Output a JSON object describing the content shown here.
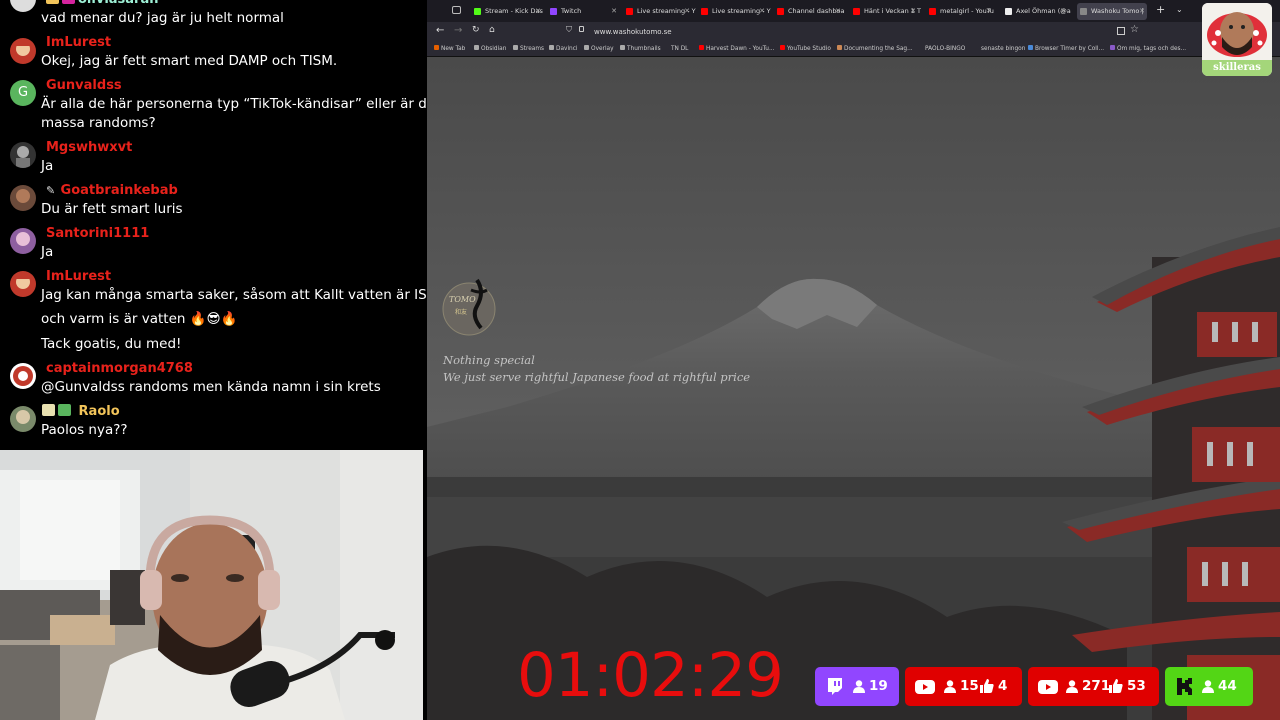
{
  "chat": {
    "messages": [
      {
        "user": "oliviasarah",
        "user_color": "#9ef0d6",
        "text": [
          "vad menar du? jag är ju helt normal"
        ]
      },
      {
        "user": "ImLurest",
        "user_color": "#e8221b",
        "text": [
          "Okej, jag är fett smart med DAMP och TISM."
        ]
      },
      {
        "user": "Gunvaldss",
        "user_color": "#e8221b",
        "avatar_letter": "G",
        "text": [
          "Är alla de här personerna typ “TikTok-kändisar” eller är de",
          "massa randoms?"
        ]
      },
      {
        "user": "Mgswhwxvt",
        "user_color": "#e8221b",
        "text": [
          "Ja"
        ]
      },
      {
        "user": "Goatbrainkebab",
        "user_color": "#e8221b",
        "text": [
          "Du är fett smart luris"
        ]
      },
      {
        "user": "Santorini1111",
        "user_color": "#e8221b",
        "text": [
          "Ja"
        ]
      },
      {
        "user": "ImLurest",
        "user_color": "#e8221b",
        "text": [
          "Jag kan många smarta saker, såsom att Kallt vatten är IS,",
          "och varm is är vatten 🔥😎🔥",
          "Tack goatis, du med!"
        ]
      },
      {
        "user": "captainmorgan4768",
        "user_color": "#e8221b",
        "text": [
          "@Gunvaldss randoms men kända namn i sin krets"
        ]
      },
      {
        "user": "Raolo",
        "user_color": "#f2c45a",
        "text": [
          "Paolos nya??"
        ]
      }
    ]
  },
  "browser": {
    "tabs": [
      {
        "label": "Stream - Kick Das",
        "color": "#53fc18"
      },
      {
        "label": "Twitch",
        "color": "#9146ff"
      },
      {
        "label": "Live streaming - Y",
        "color": "#ff0000"
      },
      {
        "label": "Live streaming - Y",
        "color": "#ff0000"
      },
      {
        "label": "Channel dashboa",
        "color": "#ff0000"
      },
      {
        "label": "Hänt i Veckan 1 T",
        "color": "#ff0000"
      },
      {
        "label": "metalgirl - YouTu",
        "color": "#ff0000"
      },
      {
        "label": "Axel Öhman (@a",
        "color": "#111111"
      },
      {
        "label": "Washoku Tomo |",
        "color": "#777777"
      }
    ],
    "url": "www.washokutomo.se",
    "bookmarks": [
      "New Tab",
      "Obsidian",
      "Streams",
      "Davinci",
      "Overlay",
      "Thumbnails",
      "TN DL",
      "Harvest Dawn - YouTu...",
      "YouTube Studio",
      "Documenting the Sag...",
      "PAOLO-BINGO",
      "senaste bingon",
      "Browser Timer by Coll...",
      "Om mig, tags och des..."
    ]
  },
  "site": {
    "logo_text": "TOMO",
    "logo_sub": "和友",
    "tagline1": "Nothing special",
    "tagline2": "We just serve rightful Japanese food at rightful price"
  },
  "overlay": {
    "timer": "01:02:29",
    "sticker_label": "skilleras",
    "stats": [
      {
        "platform": "twitch",
        "color": "#9146ff",
        "viewers": "19"
      },
      {
        "platform": "youtube",
        "color": "#e00000",
        "viewers": "15",
        "likes": "4"
      },
      {
        "platform": "youtube",
        "color": "#e00000",
        "viewers": "271",
        "likes": "53"
      },
      {
        "platform": "kick",
        "color": "#53d615",
        "viewers": "44"
      }
    ]
  }
}
